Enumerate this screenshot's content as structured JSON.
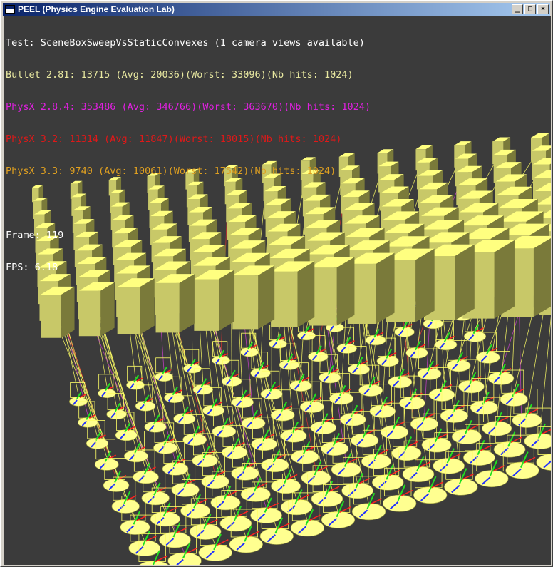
{
  "window": {
    "title": "PEEL (Physics Engine Evaluation Lab)",
    "icon": "app-window-icon",
    "buttons": {
      "minimize": "_",
      "maximize": "□",
      "close": "×"
    }
  },
  "hud": {
    "test_line": "Test: SceneBoxSweepVsStaticConvexes (1 camera views available)",
    "engines": [
      {
        "text": "Bullet 2.81: 13715 (Avg: 20036)(Worst: 33096)(Nb hits: 1024)",
        "color": "#e8e8a0"
      },
      {
        "text": "PhysX 2.8.4: 353486 (Avg: 346766)(Worst: 363670)(Nb hits: 1024)",
        "color": "#e020e0"
      },
      {
        "text": "PhysX 3.2: 11314 (Avg: 11847)(Worst: 18015)(Nb hits: 1024)",
        "color": "#e01818"
      },
      {
        "text": "PhysX 3.3: 9740 (Avg: 10061)(Worst: 17542)(Nb hits: 1024)",
        "color": "#e0a020"
      }
    ],
    "frame": "Frame: 119",
    "fps": "FPS: 6.18",
    "text_color": "#ffffff"
  },
  "colors": {
    "background": "#3b3b3b",
    "box_top": "#ffff80",
    "box_side": "#7a7a3a",
    "box_front": "#c8c868",
    "convex": "#ffff90",
    "sweep_line": "#ffff66"
  }
}
